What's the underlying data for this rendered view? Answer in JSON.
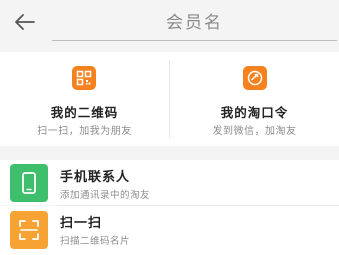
{
  "header": {
    "back_icon": "back-arrow-icon",
    "search_placeholder": "会员名"
  },
  "tiles": [
    {
      "title": "我的二维码",
      "subtitle": "扫一扫，加我为朋友",
      "icon": "qr-code-icon",
      "icon_color": "#f5821f"
    },
    {
      "title": "我的淘口令",
      "subtitle": "发到微信，加淘友",
      "icon": "share-link-icon",
      "icon_color": "#f5821f"
    }
  ],
  "rows": [
    {
      "title": "手机联系人",
      "subtitle": "添加通讯录中的淘友",
      "icon": "phone-icon",
      "icon_color": "#3dbf6b"
    },
    {
      "title": "扫一扫",
      "subtitle": "扫描二维码名片",
      "icon": "scan-icon",
      "icon_color": "#f7a334"
    }
  ]
}
